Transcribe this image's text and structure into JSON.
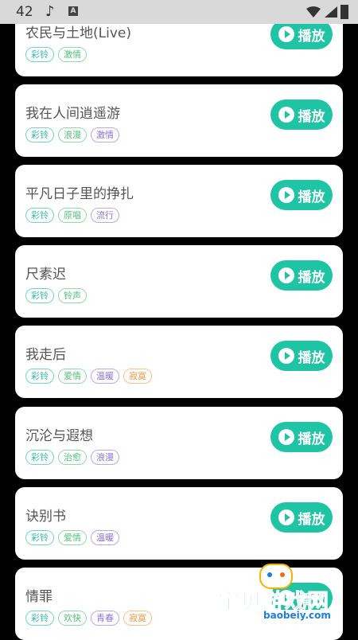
{
  "status_bar": {
    "time": "42",
    "icons": [
      "music-note-icon",
      "a-icon",
      "wifi-icon",
      "signal-icon",
      "battery-icon"
    ]
  },
  "play_label": "播放",
  "songs": [
    {
      "title": "农民与土地(Live)",
      "tags": [
        {
          "text": "彩铃",
          "color": "teal"
        },
        {
          "text": "激情",
          "color": "green"
        }
      ]
    },
    {
      "title": "我在人间逍遥游",
      "tags": [
        {
          "text": "彩铃",
          "color": "teal"
        },
        {
          "text": "浪漫",
          "color": "green"
        },
        {
          "text": "激情",
          "color": "purple"
        }
      ]
    },
    {
      "title": "平凡日子里的挣扎",
      "tags": [
        {
          "text": "彩铃",
          "color": "teal"
        },
        {
          "text": "原唱",
          "color": "green"
        },
        {
          "text": "流行",
          "color": "purple"
        }
      ]
    },
    {
      "title": "尺素迟",
      "tags": [
        {
          "text": "彩铃",
          "color": "teal"
        },
        {
          "text": "铃声",
          "color": "green"
        }
      ]
    },
    {
      "title": "我走后",
      "tags": [
        {
          "text": "彩铃",
          "color": "teal"
        },
        {
          "text": "爱情",
          "color": "green"
        },
        {
          "text": "温暖",
          "color": "purple"
        },
        {
          "text": "寂寞",
          "color": "orange"
        }
      ]
    },
    {
      "title": "沉沦与遐想",
      "tags": [
        {
          "text": "彩铃",
          "color": "teal"
        },
        {
          "text": "治愈",
          "color": "green"
        },
        {
          "text": "浪漫",
          "color": "purple"
        }
      ]
    },
    {
      "title": "诀别书",
      "tags": [
        {
          "text": "彩铃",
          "color": "teal"
        },
        {
          "text": "爱情",
          "color": "green"
        },
        {
          "text": "温暖",
          "color": "purple"
        }
      ]
    },
    {
      "title": "情罪",
      "tags": [
        {
          "text": "彩铃",
          "color": "teal"
        },
        {
          "text": "欢快",
          "color": "green"
        },
        {
          "text": "青春",
          "color": "purple"
        },
        {
          "text": "寂寞",
          "color": "orange"
        }
      ]
    }
  ],
  "watermark": {
    "text": "宝贝游戏网",
    "url": "baobeiy.com"
  },
  "colors": {
    "accent": "#1fc4a5",
    "background": "#000000",
    "card": "#ffffff"
  }
}
